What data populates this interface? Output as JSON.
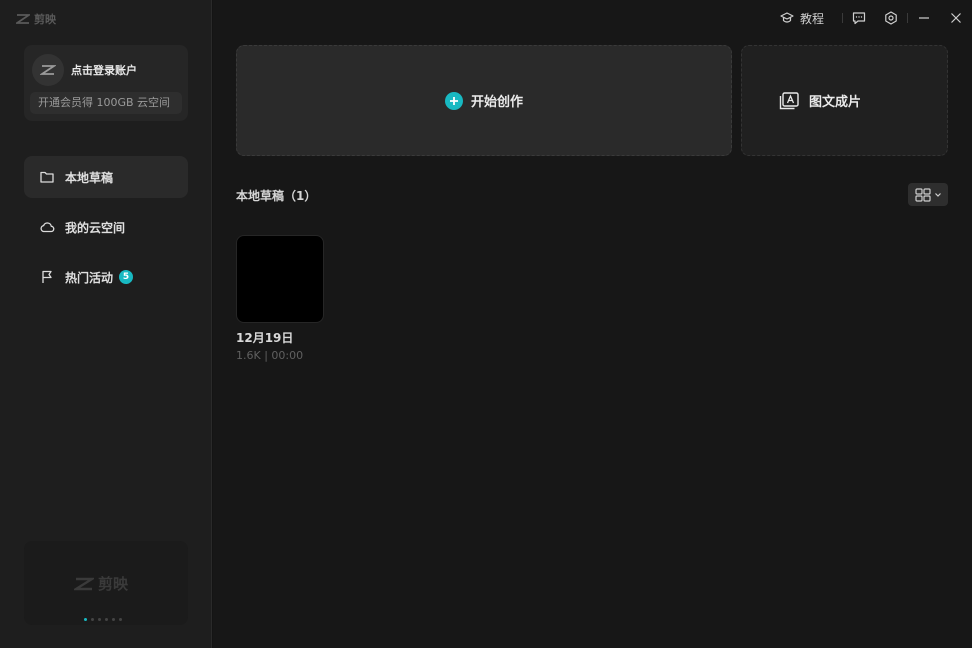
{
  "app": {
    "name": "剪映"
  },
  "account": {
    "login_label": "点击登录账户",
    "vip_promo": "开通会员得 100GB 云空间"
  },
  "sidebar": {
    "items": [
      {
        "label": "本地草稿",
        "icon": "folder-icon",
        "active": true
      },
      {
        "label": "我的云空间",
        "icon": "cloud-icon",
        "active": false
      },
      {
        "label": "热门活动",
        "icon": "flag-icon",
        "active": false,
        "badge": "5"
      }
    ]
  },
  "promo": {
    "logo_text": "剪映"
  },
  "topbar": {
    "tutorial_label": "教程"
  },
  "actions": {
    "start_create": "开始创作",
    "text_to_video": "图文成片"
  },
  "drafts": {
    "section_title": "本地草稿（1）",
    "items": [
      {
        "title": "12月19日",
        "meta": "1.6K | 00:00"
      }
    ]
  },
  "colors": {
    "accent": "#18b9c2",
    "sidebar_bg": "#1e1e1e",
    "main_bg": "#171717",
    "card_bg": "#2a2a2a"
  }
}
